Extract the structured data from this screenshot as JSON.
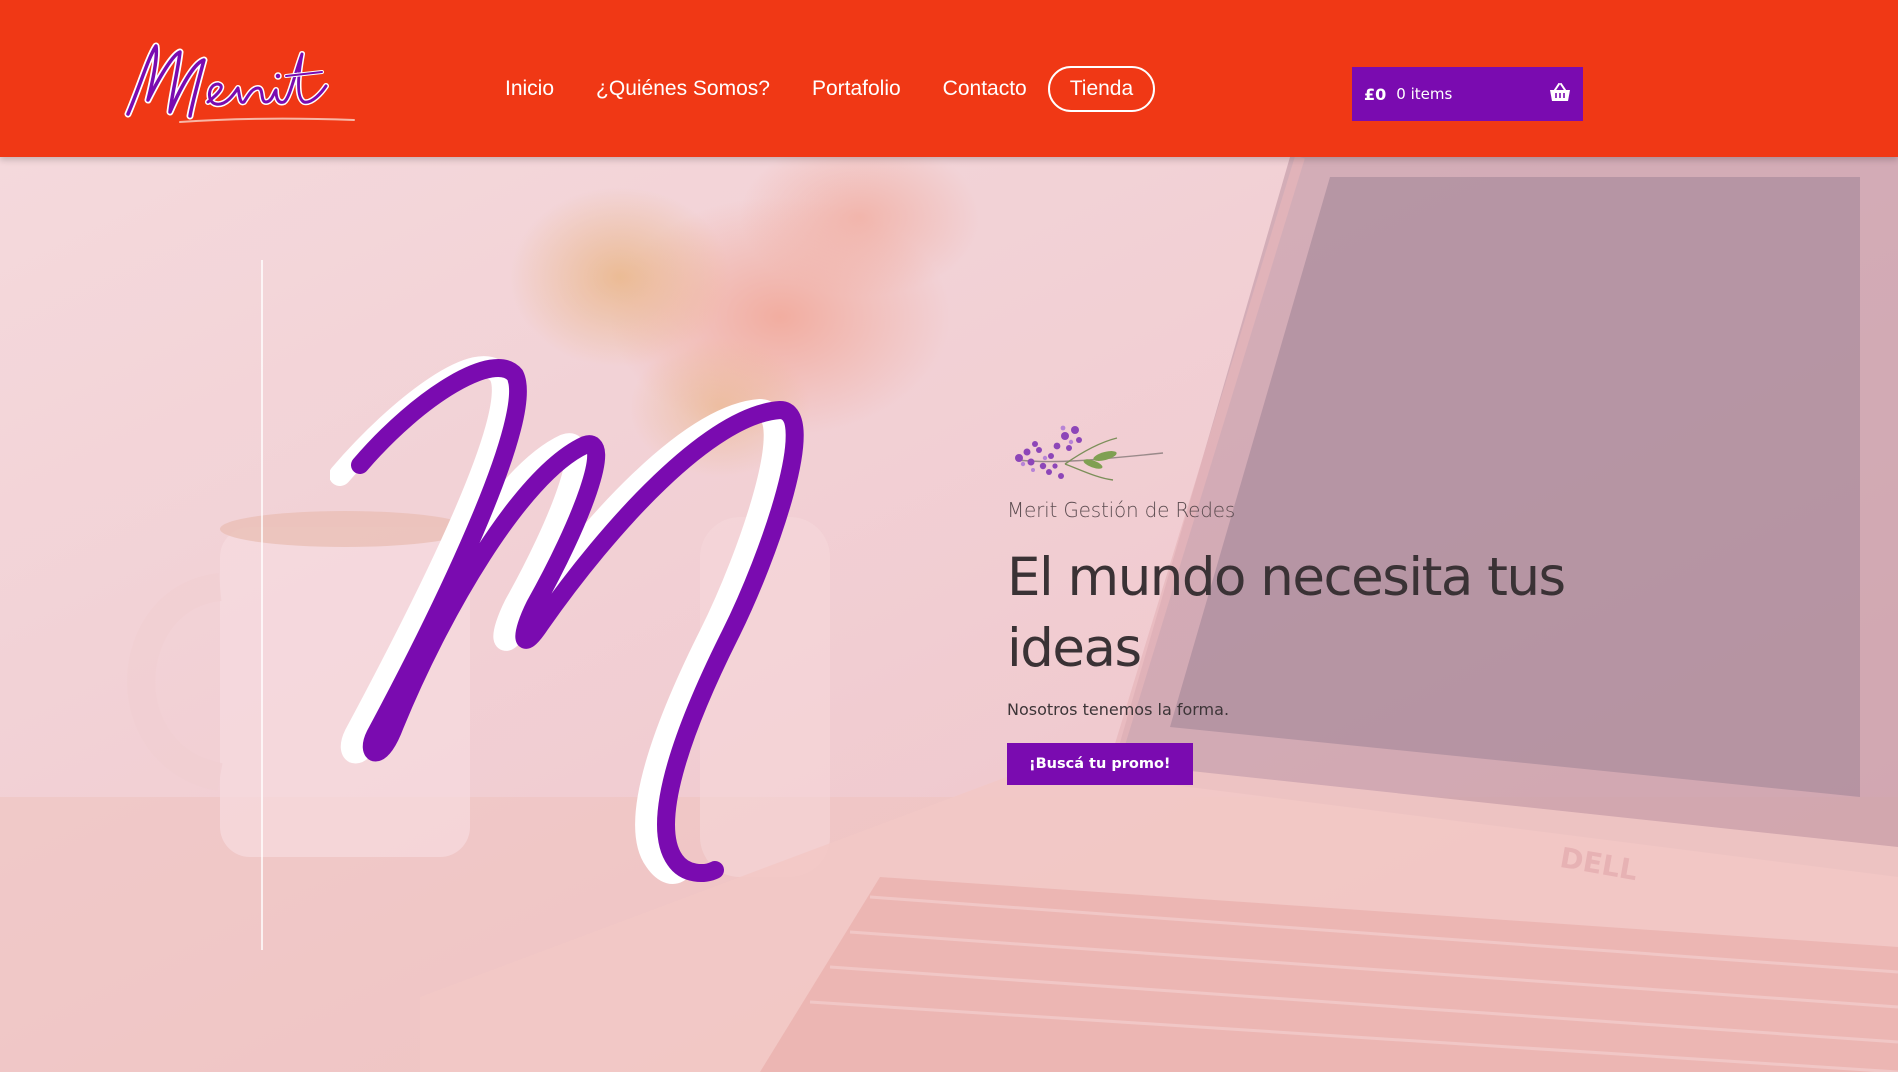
{
  "header": {
    "logo_text": "Merit",
    "nav": [
      {
        "label": "Inicio"
      },
      {
        "label": "¿Quiénes Somos?"
      },
      {
        "label": "Portafolio"
      },
      {
        "label": "Contacto"
      },
      {
        "label": "Tienda"
      }
    ],
    "cart": {
      "amount": "£0",
      "items": "0 items",
      "icon": "basket-icon"
    }
  },
  "hero": {
    "kicker": "Merit Gestión de Redes",
    "headline": "El mundo necesita tus ideas",
    "tagline": "Nosotros tenemos la forma.",
    "cta_label": "¡Buscá tu promo!",
    "laptop_brand": "DELL"
  },
  "colors": {
    "header_bg": "#f03815",
    "accent_purple": "#7a0bb0",
    "hero_overlay": "#f3d4d8"
  }
}
